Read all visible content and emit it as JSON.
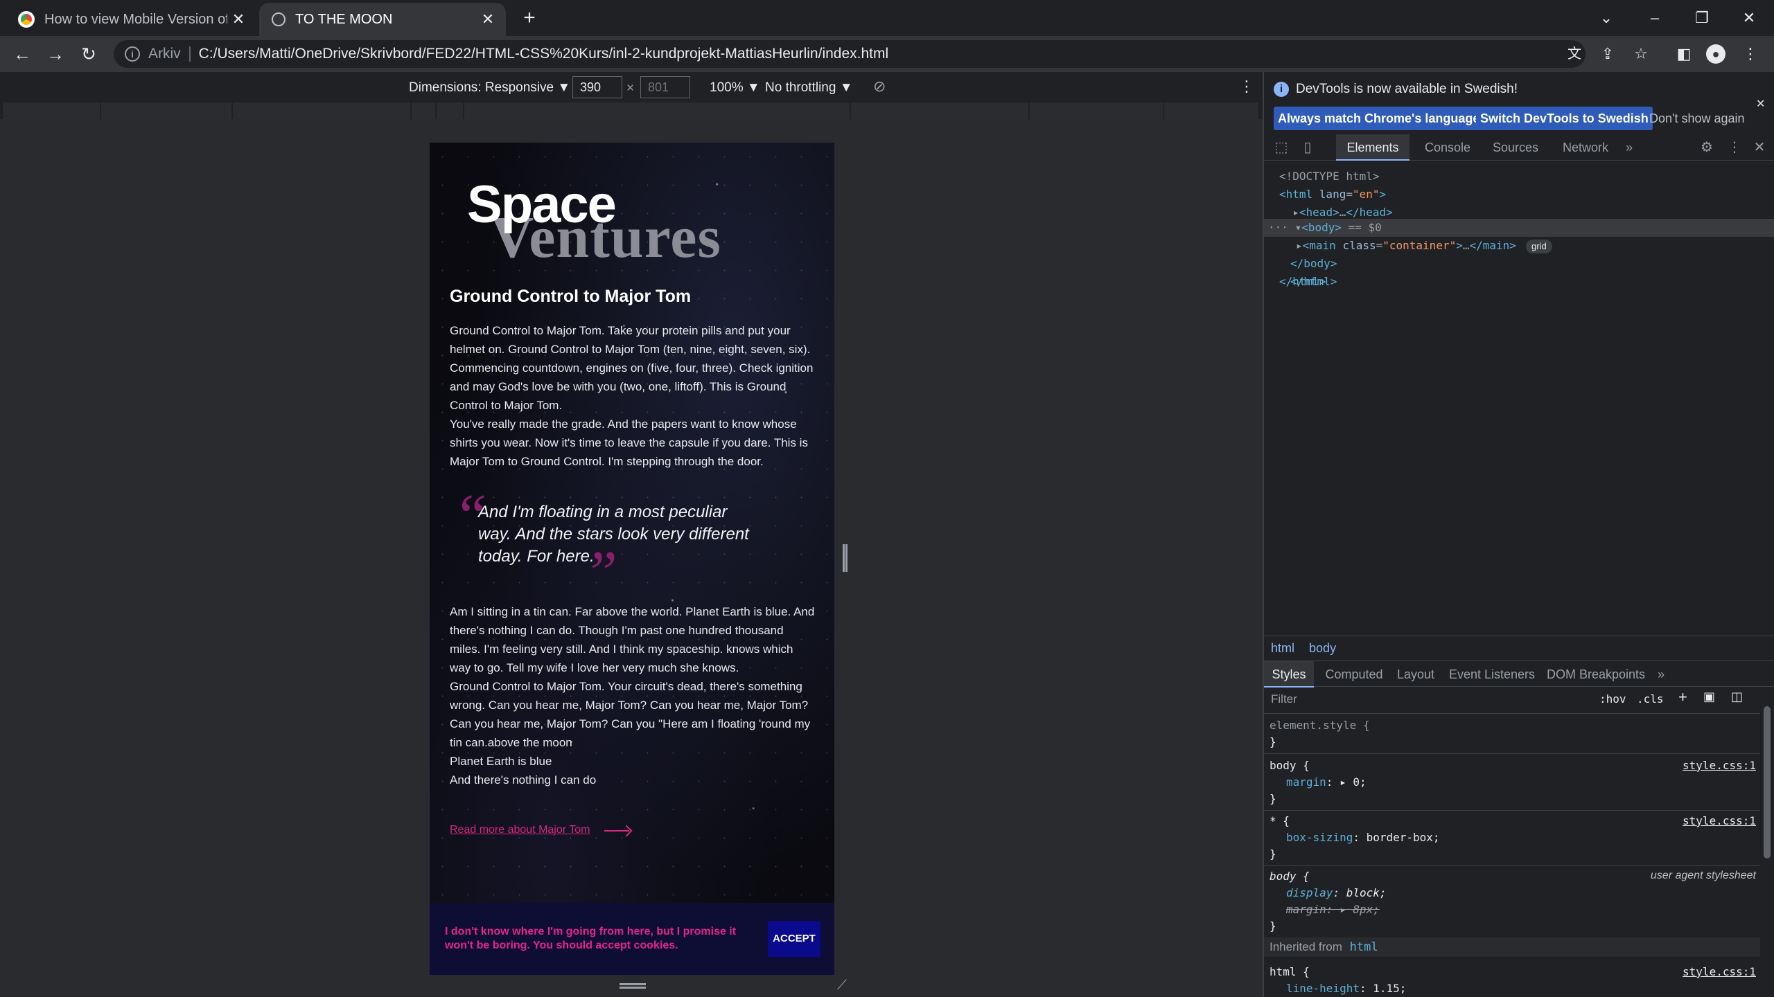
{
  "tabs": [
    {
      "title": "How to view Mobile Version of a",
      "active": false
    },
    {
      "title": "TO THE MOON",
      "active": true
    }
  ],
  "address": {
    "scheme": "Arkiv",
    "url": "C:/Users/Matti/OneDrive/Skrivbord/FED22/HTML-CSS%20Kurs/inl-2-kundprojekt-MattiasHeurlin/index.html"
  },
  "device_toolbar": {
    "dimensions": "Dimensions: Responsive ▼",
    "width": "390",
    "times": "×",
    "height": "801",
    "zoom": "100% ▼",
    "throttling": "No throttling ▼"
  },
  "page": {
    "logo_top": "Space",
    "logo_bottom": "Ventures",
    "heading": "Ground Control to Major Tom",
    "para1": [
      "Ground Control to Major Tom. Take your protein pills and put your",
      "helmet on. Ground Control to Major Tom (ten, nine, eight, seven, six).",
      "Commencing countdown, engines on (five, four, three). Check ignition",
      "and may God's love be with you (two, one, liftoff). This is Ground",
      "Control to Major Tom.",
      "You've really made the grade. And the papers want to know whose",
      "shirts you wear. Now it's time to leave the capsule if you dare. This is",
      "Major Tom to Ground Control. I'm stepping through the door."
    ],
    "quote": [
      "And I'm floating in a most peculiar",
      "way. And the stars look very different",
      "today. For here."
    ],
    "para2": [
      "Am I sitting in a tin can. Far above the world. Planet Earth is blue. And",
      "there's nothing I can do. Though I'm past one hundred thousand",
      "miles. I'm feeling very still. And I think my spaceship. knows which",
      "way to go. Tell my wife I love her very much she knows.",
      "Ground Control to Major Tom. Your circuit's dead, there's something",
      "wrong. Can you hear me, Major Tom? Can you hear me, Major Tom?",
      "Can you hear me, Major Tom? Can you \"Here am I floating 'round my",
      "tin can.above the moon",
      "Planet Earth is blue",
      "And there's nothing I can do"
    ],
    "link": "Read more about Major Tom",
    "cookie_text": [
      "I don't know where I'm going from here, but I promise it",
      "won't be boring. You should accept cookies."
    ],
    "cookie_button": "ACCEPT"
  },
  "devtools": {
    "banner": "DevTools is now available in Swedish!",
    "btn_match": "Always match Chrome's language",
    "btn_switch": "Switch DevTools to Swedish",
    "btn_dismiss": "Don't show again",
    "tabs": [
      "Elements",
      "Console",
      "Sources",
      "Network",
      "»"
    ],
    "breadcrumbs": [
      "html",
      "body"
    ],
    "style_tabs": [
      "Styles",
      "Computed",
      "Layout",
      "Event Listeners",
      "DOM Breakpoints",
      "»"
    ],
    "filter_placeholder": "Filter",
    "hov": ":hov",
    "cls": ".cls",
    "rules": {
      "element_style": "element.style {",
      "close": "}",
      "body1_sel": "body {",
      "body1_prop": "margin",
      "body1_val": "0;",
      "star_sel": "* {",
      "star_prop": "box-sizing",
      "star_val": "border-box;",
      "body2_sel": "body {",
      "body2_src": "user agent stylesheet",
      "body2_prop1": "display",
      "body2_val1": "block;",
      "body2_prop2": "margin",
      "body2_val2": "8px;",
      "inherited": "Inherited from",
      "inherited_tag": "html",
      "html_sel": "html {",
      "html_prop": "line-height",
      "html_val": "1.15;",
      "src": "style.css:1"
    }
  }
}
